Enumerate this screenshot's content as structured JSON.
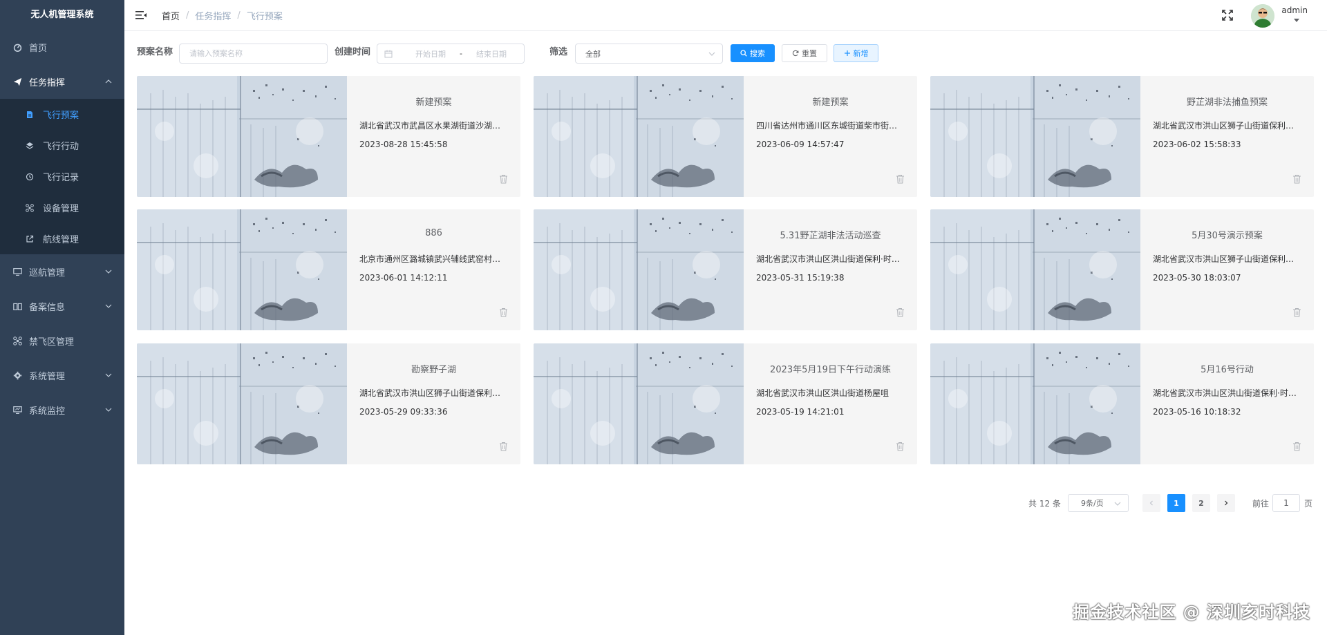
{
  "app": {
    "title": "无人机管理系统"
  },
  "sidebar": {
    "items": [
      {
        "label": "首页",
        "icon": "dashboard-icon"
      },
      {
        "label": "任务指挥",
        "icon": "send-icon",
        "expanded": true,
        "children": [
          {
            "label": "飞行预案",
            "icon": "document-icon",
            "active": true
          },
          {
            "label": "飞行行动",
            "icon": "layers-icon"
          },
          {
            "label": "飞行记录",
            "icon": "history-icon"
          },
          {
            "label": "设备管理",
            "icon": "drone-icon"
          },
          {
            "label": "航线管理",
            "icon": "external-link-icon"
          }
        ]
      },
      {
        "label": "巡航管理",
        "icon": "monitor-icon"
      },
      {
        "label": "备案信息",
        "icon": "book-icon"
      },
      {
        "label": "禁飞区管理",
        "icon": "drone-icon"
      },
      {
        "label": "系统管理",
        "icon": "gear-icon"
      },
      {
        "label": "系统监控",
        "icon": "monitor-icon"
      }
    ]
  },
  "topbar": {
    "breadcrumb": [
      "首页",
      "任务指挥",
      "飞行预案"
    ],
    "user": {
      "name": "admin"
    }
  },
  "filters": {
    "name_label": "预案名称",
    "name_placeholder": "请输入预案名称",
    "name_value": "",
    "time_label": "创建时间",
    "start_placeholder": "开始日期",
    "range_separator": "-",
    "end_placeholder": "结束日期",
    "filter_label": "筛选",
    "filter_value": "全部",
    "search_button": "搜索",
    "reset_button": "重置",
    "add_button": "新增"
  },
  "cards": [
    {
      "title": "新建预案",
      "address": "湖北省武汉市武昌区水果湖街道沙湖社区",
      "time": "2023-08-28 15:45:58"
    },
    {
      "title": "新建预案",
      "address": "四川省达州市通川区东城街道柴市街社区",
      "time": "2023-06-09 14:57:47"
    },
    {
      "title": "野芷湖非法捕鱼预案",
      "address": "湖北省武汉市洪山区狮子山街道保利社区",
      "time": "2023-06-02 15:58:33"
    },
    {
      "title": "886",
      "address": "北京市通州区潞城镇武兴辅线武窑村委会",
      "time": "2023-06-01 14:12:11"
    },
    {
      "title": "5.31野芷湖非法活动巡查",
      "address": "湖北省武汉市洪山区洪山街道保利·时代社区",
      "time": "2023-05-31 15:19:38"
    },
    {
      "title": "5月30号演示预案",
      "address": "湖北省武汉市洪山区狮子山街道保利社区",
      "time": "2023-05-30 18:03:07"
    },
    {
      "title": "勘察野子湖",
      "address": "湖北省武汉市洪山区狮子山街道保利社区",
      "time": "2023-05-29 09:33:36"
    },
    {
      "title": "2023年5月19日下午行动演练",
      "address": "湖北省武汉市洪山区洪山街道杨屋咀",
      "time": "2023-05-19 14:21:01"
    },
    {
      "title": "5月16号行动",
      "address": "湖北省武汉市洪山区洪山街道保利·时代社区",
      "time": "2023-05-16 10:18:32"
    }
  ],
  "pagination": {
    "total_text": "共 12 条",
    "page_size": "9条/页",
    "pages": [
      "1",
      "2"
    ],
    "current_page": 1,
    "jump_label": "前往",
    "jump_value": "1",
    "page_suffix": "页"
  },
  "watermark": "掘金技术社区 @ 深圳亥时科技",
  "colors": {
    "sidebar_bg": "#304156",
    "submenu_bg": "#1f2d3d",
    "accent": "#1890ff",
    "active_text": "#409eff"
  }
}
